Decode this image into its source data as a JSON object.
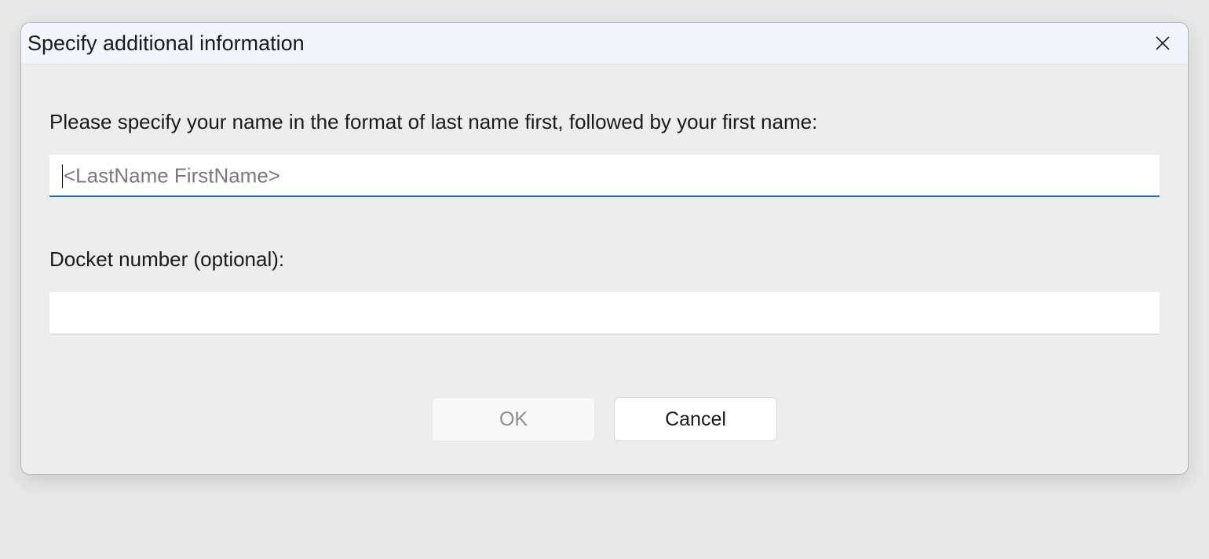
{
  "dialog": {
    "title": "Specify additional information",
    "name_field": {
      "label": "Please specify your name in the format of last name first, followed by your first name:",
      "placeholder": "<LastName FirstName>",
      "value": ""
    },
    "docket_field": {
      "label": "Docket number (optional):",
      "value": ""
    },
    "buttons": {
      "ok": "OK",
      "cancel": "Cancel"
    }
  }
}
